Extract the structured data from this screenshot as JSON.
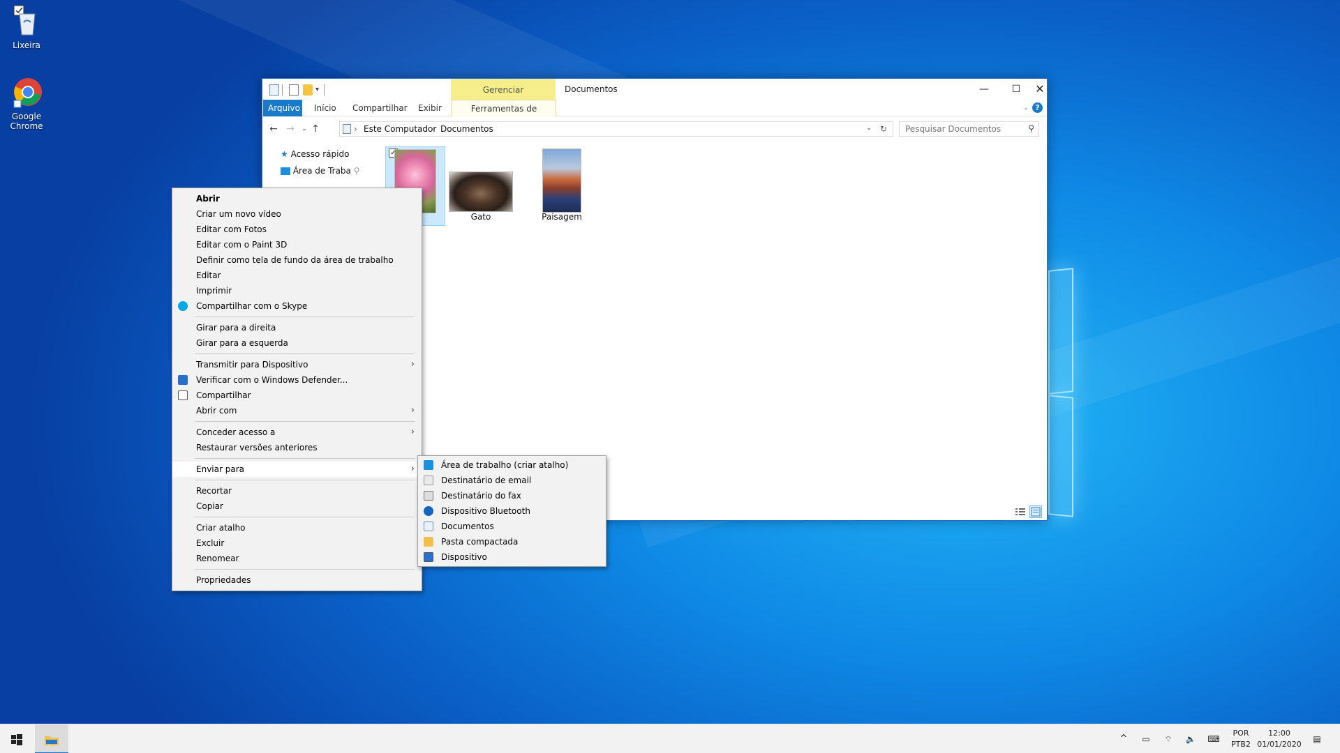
{
  "desktop": {
    "icons": [
      {
        "label": "Lixeira",
        "icon": "recycle-bin-icon"
      },
      {
        "label": "Google Chrome",
        "icon": "chrome-icon"
      }
    ]
  },
  "window": {
    "title": "Documentos",
    "contextual_group": "Gerenciar",
    "ribbon": {
      "tabs": [
        "Arquivo",
        "Início",
        "Compartilhar",
        "Exibir",
        "Ferramentas de Imagem"
      ]
    },
    "address": {
      "crumbs": [
        "Este Computador",
        "Documentos"
      ],
      "search_placeholder": "Pesquisar Documentos"
    },
    "nav": {
      "items": [
        "Acesso rápido",
        "Área de Traba"
      ]
    },
    "files": [
      {
        "name": "Flor",
        "visible_label": "or",
        "selected": true
      },
      {
        "name": "Gato",
        "visible_label": "Gato"
      },
      {
        "name": "Paisagem",
        "visible_label": "Paisagem"
      }
    ]
  },
  "context_menu": {
    "groups": [
      [
        {
          "label": "Abrir",
          "bold": true
        },
        {
          "label": "Criar um novo vídeo"
        },
        {
          "label": "Editar com Fotos"
        },
        {
          "label": "Editar com o Paint 3D"
        },
        {
          "label": "Definir como tela de fundo da área de trabalho"
        },
        {
          "label": "Editar"
        },
        {
          "label": "Imprimir"
        },
        {
          "label": "Compartilhar com o Skype",
          "icon": "skype-icon"
        }
      ],
      [
        {
          "label": "Girar para a direita"
        },
        {
          "label": "Girar para a esquerda"
        }
      ],
      [
        {
          "label": "Transmitir para Dispositivo",
          "submenu": true
        },
        {
          "label": "Verificar com o Windows Defender...",
          "icon": "defender-icon"
        },
        {
          "label": "Compartilhar",
          "icon": "share-icon"
        },
        {
          "label": "Abrir com",
          "submenu": true
        }
      ],
      [
        {
          "label": "Conceder acesso a",
          "submenu": true
        },
        {
          "label": "Restaurar versões anteriores"
        }
      ],
      [
        {
          "label": "Enviar para",
          "submenu": true,
          "highlighted": true
        }
      ],
      [
        {
          "label": "Recortar"
        },
        {
          "label": "Copiar"
        }
      ],
      [
        {
          "label": "Criar atalho"
        },
        {
          "label": "Excluir"
        },
        {
          "label": "Renomear"
        }
      ],
      [
        {
          "label": "Propriedades"
        }
      ]
    ]
  },
  "send_to_menu": [
    {
      "label": "Área de trabalho (criar atalho)",
      "icon": "desktop-icon"
    },
    {
      "label": "Destinatário de email",
      "icon": "mail-icon"
    },
    {
      "label": "Destinatário do fax",
      "icon": "fax-icon"
    },
    {
      "label": "Dispositivo Bluetooth",
      "icon": "bluetooth-icon"
    },
    {
      "label": "Documentos",
      "icon": "documents-icon"
    },
    {
      "label": "Pasta compactada",
      "icon": "zip-folder-icon"
    },
    {
      "label": "Dispositivo",
      "icon": "device-icon"
    }
  ],
  "taskbar": {
    "lang_top": "POR",
    "lang_bottom": "PTB2",
    "time": "12:00",
    "date": "01/01/2020"
  }
}
